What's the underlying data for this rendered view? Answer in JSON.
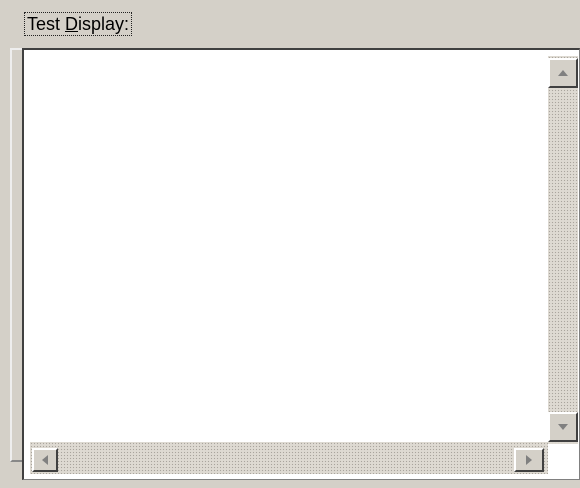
{
  "group": {
    "label_first": "Test ",
    "label_mnemonic": "D",
    "label_rest": "isplay:"
  },
  "listbox": {
    "items": []
  },
  "scrollbars": {
    "vertical": {
      "up_icon": "triangle-up-icon",
      "down_icon": "triangle-down-icon"
    },
    "horizontal": {
      "left_icon": "triangle-left-icon",
      "right_icon": "triangle-right-icon"
    }
  },
  "colors": {
    "face": "#d4d0c8",
    "window": "#ffffff",
    "shadow": "#808080",
    "dark_shadow": "#404040",
    "arrow": "#808080"
  }
}
